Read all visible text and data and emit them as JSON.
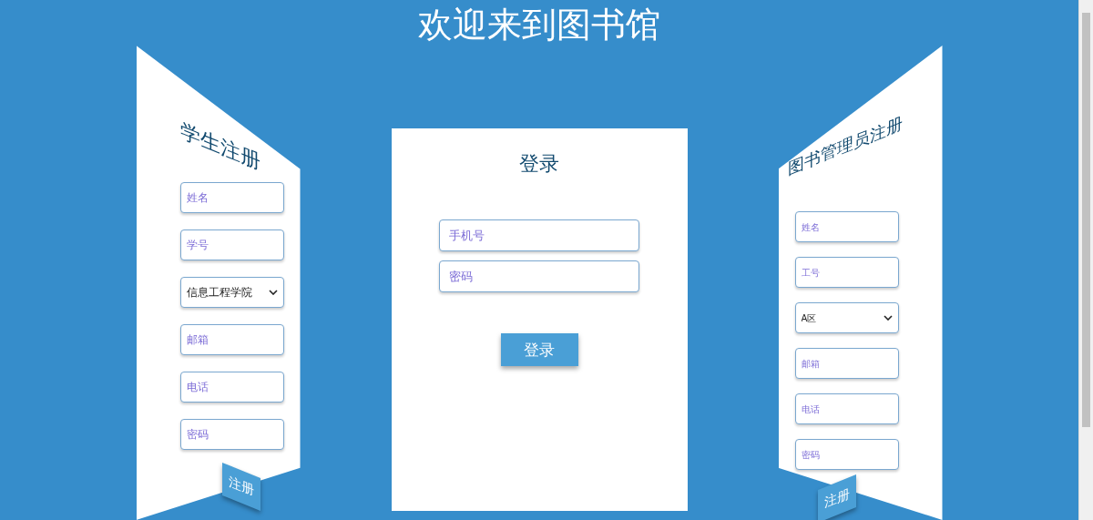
{
  "title": "欢迎来到图书馆",
  "student_form": {
    "title": "学生注册",
    "fields": [
      {
        "kind": "input",
        "placeholder": "姓名"
      },
      {
        "kind": "input",
        "placeholder": "学号"
      },
      {
        "kind": "select",
        "value": "信息工程学院"
      },
      {
        "kind": "input",
        "placeholder": "邮箱"
      },
      {
        "kind": "input",
        "placeholder": "电话"
      },
      {
        "kind": "input",
        "placeholder": "密码"
      }
    ],
    "button": "注册"
  },
  "login_form": {
    "title": "登录",
    "fields": [
      {
        "kind": "input",
        "placeholder": "手机号"
      },
      {
        "kind": "input",
        "placeholder": "密码"
      }
    ],
    "button": "登录"
  },
  "admin_form": {
    "title": "图书管理员注册",
    "fields": [
      {
        "kind": "input",
        "placeholder": "姓名"
      },
      {
        "kind": "input",
        "placeholder": "工号"
      },
      {
        "kind": "select",
        "value": "A区"
      },
      {
        "kind": "input",
        "placeholder": "邮箱"
      },
      {
        "kind": "input",
        "placeholder": "电话"
      },
      {
        "kind": "input",
        "placeholder": "密码"
      }
    ],
    "button": "注册"
  }
}
